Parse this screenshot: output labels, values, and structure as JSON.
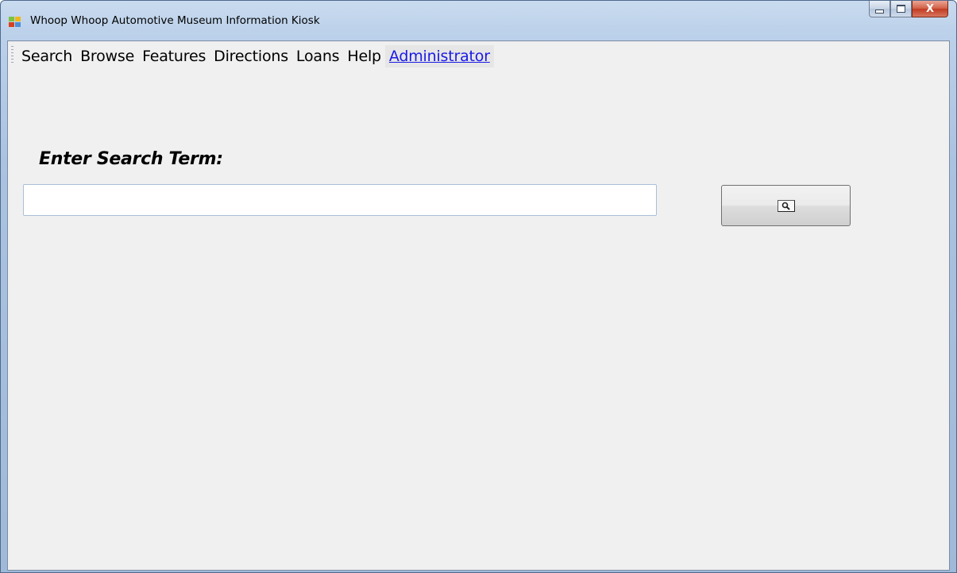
{
  "window": {
    "title": "Whoop Whoop Automotive Museum Information Kiosk",
    "icon": "app-icon"
  },
  "caption_buttons": {
    "minimize_icon": "minimize-icon",
    "maximize_icon": "maximize-icon",
    "close_label": "X"
  },
  "menu": {
    "items": [
      {
        "label": "Search"
      },
      {
        "label": "Browse"
      },
      {
        "label": "Features"
      },
      {
        "label": "Directions"
      },
      {
        "label": "Loans"
      },
      {
        "label": "Help"
      },
      {
        "label": "Administrator"
      }
    ]
  },
  "search": {
    "label": "Enter Search Term:",
    "value": "",
    "placeholder": "",
    "button_icon": "search-icon"
  },
  "colors": {
    "link": "#1a1ae6",
    "client_background": "#f0f0f0",
    "close_button": "#c13b22"
  }
}
